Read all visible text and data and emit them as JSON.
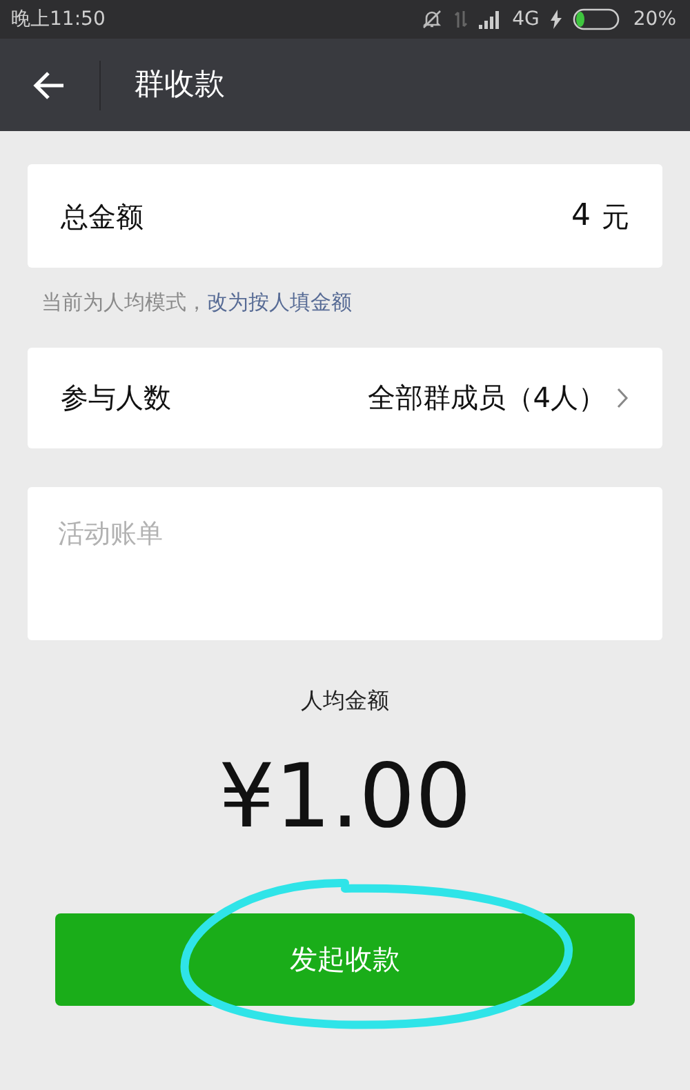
{
  "status_bar": {
    "time": "晚上11:50",
    "network": "4G",
    "battery": "20%"
  },
  "title_bar": {
    "title": "群收款"
  },
  "amount": {
    "label": "总金额",
    "value": "4",
    "unit": "元"
  },
  "hint": {
    "text": "当前为人均模式，",
    "link": "改为按人填金额"
  },
  "participants": {
    "label": "参与人数",
    "value": "全部群成员（4人）"
  },
  "note": {
    "placeholder": "活动账单"
  },
  "per_person": {
    "label": "人均金额",
    "amount": "¥1.00"
  },
  "submit": {
    "label": "发起收款"
  }
}
